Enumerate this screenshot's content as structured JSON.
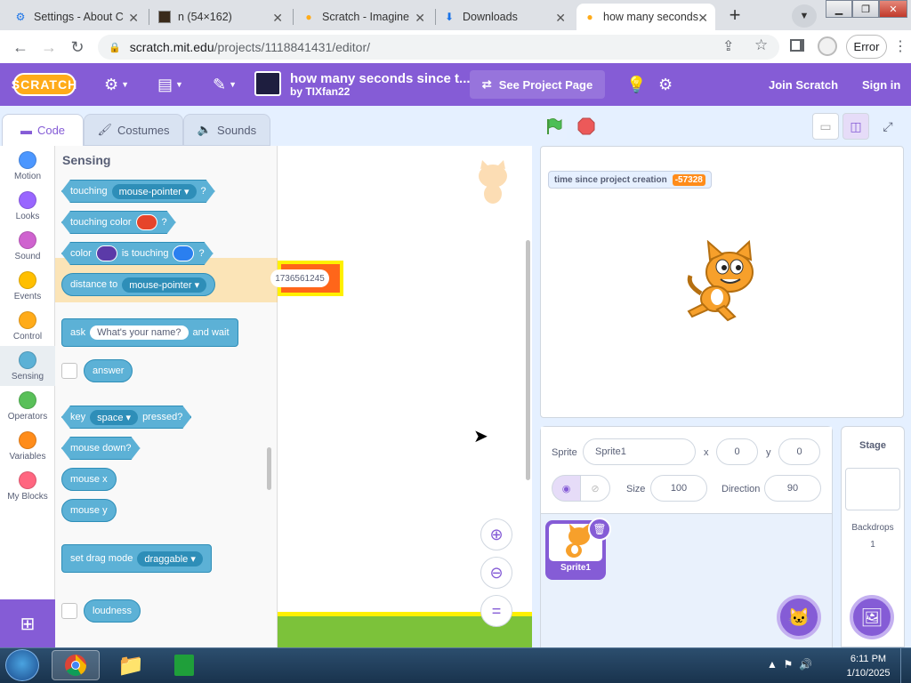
{
  "browser": {
    "tabs": [
      {
        "label": "Settings - About C",
        "icon": "gear-icon"
      },
      {
        "label": "n (54×162)",
        "icon": "image-icon"
      },
      {
        "label": "Scratch - Imagine",
        "icon": "scratch-icon"
      },
      {
        "label": "Downloads",
        "icon": "download-icon"
      },
      {
        "label": "how many seconds",
        "icon": "scratch-icon"
      }
    ],
    "url_host": "scratch.mit.edu",
    "url_path": "/projects/1118841431/editor/",
    "error_label": "Error"
  },
  "menu": {
    "logo": "SCRATCH",
    "project_title": "how many seconds since t...",
    "author": "by TIXfan22",
    "see_project": "See Project Page",
    "join": "Join Scratch",
    "signin": "Sign in"
  },
  "editor_tabs": {
    "code": "Code",
    "costumes": "Costumes",
    "sounds": "Sounds"
  },
  "categories": [
    {
      "label": "Motion",
      "color": "#4c97ff"
    },
    {
      "label": "Looks",
      "color": "#9966ff"
    },
    {
      "label": "Sound",
      "color": "#cf63cf"
    },
    {
      "label": "Events",
      "color": "#ffbf00"
    },
    {
      "label": "Control",
      "color": "#ffab19"
    },
    {
      "label": "Sensing",
      "color": "#5cb1d6"
    },
    {
      "label": "Operators",
      "color": "#59c059"
    },
    {
      "label": "Variables",
      "color": "#ff8c1a"
    },
    {
      "label": "My Blocks",
      "color": "#ff6680"
    }
  ],
  "palette": {
    "heading": "Sensing",
    "touching": "touching",
    "touching_opt": "mouse-pointer",
    "q": "?",
    "touching_color": "touching color",
    "color_label": "color",
    "is_touching": "is touching",
    "distance_to": "distance to",
    "distance_opt": "mouse-pointer",
    "ask": "ask",
    "ask_input": "What's your name?",
    "and_wait": "and wait",
    "answer": "answer",
    "key": "key",
    "key_opt": "space",
    "pressed": "pressed?",
    "mouse_down": "mouse down?",
    "mouse_x": "mouse x",
    "mouse_y": "mouse y",
    "set_drag": "set drag mode",
    "drag_opt": "draggable",
    "loudness": "loudness"
  },
  "script_area": {
    "block_value": "1736561245"
  },
  "stage": {
    "monitor_label": "time since project creation",
    "monitor_value": "-57328"
  },
  "sprite_info": {
    "sprite_label": "Sprite",
    "sprite_name": "Sprite1",
    "x_label": "x",
    "x": "0",
    "y_label": "y",
    "y": "0",
    "size_label": "Size",
    "size": "100",
    "direction_label": "Direction",
    "direction": "90",
    "thumb_name": "Sprite1"
  },
  "stage_panel": {
    "title": "Stage",
    "backdrops_label": "Backdrops",
    "backdrops_count": "1"
  },
  "taskbar": {
    "time": "6:11 PM",
    "date": "1/10/2025"
  },
  "colors": {
    "scratch_purple": "#855cd6",
    "sensing": "#5cb1d6",
    "chrome_tabbar": "#dee1e6"
  }
}
